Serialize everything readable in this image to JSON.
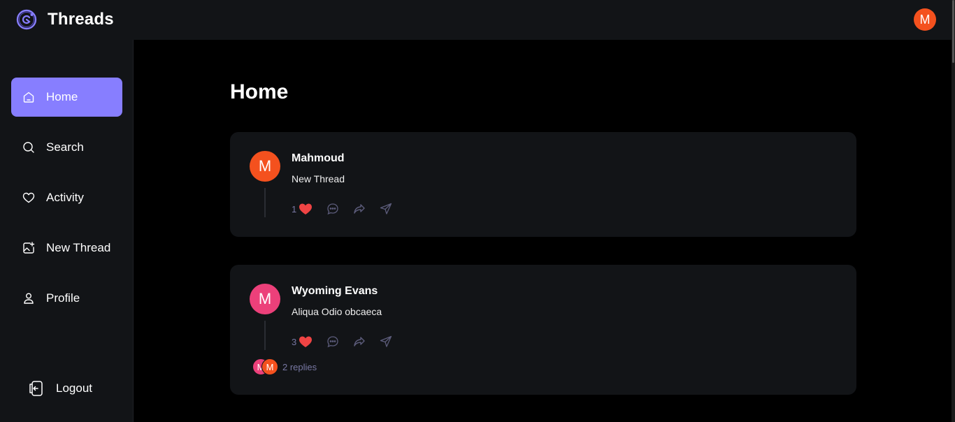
{
  "app": {
    "title": "Threads",
    "user_initial": "M",
    "accent": "#877eff"
  },
  "sidebar": {
    "items": [
      {
        "label": "Home",
        "icon": "home-icon",
        "active": true
      },
      {
        "label": "Search",
        "icon": "search-icon",
        "active": false
      },
      {
        "label": "Activity",
        "icon": "heart-icon",
        "active": false
      },
      {
        "label": "New Thread",
        "icon": "image-plus-icon",
        "active": false
      },
      {
        "label": "Profile",
        "icon": "user-icon",
        "active": false
      }
    ],
    "logout_label": "Logout"
  },
  "main": {
    "title": "Home",
    "threads": [
      {
        "author": "Mahmoud",
        "initial": "M",
        "avatar_color": "#f4511e",
        "content": "New Thread",
        "likes": "1"
      },
      {
        "author": "Wyoming Evans",
        "initial": "M",
        "avatar_color": "#ec407a",
        "content": "Aliqua Odio obcaeca",
        "likes": "3",
        "reply_avatars": [
          {
            "initial": "M",
            "color": "#ec407a"
          },
          {
            "initial": "M",
            "color": "#f4511e"
          }
        ],
        "replies_label": "2 replies"
      }
    ]
  }
}
